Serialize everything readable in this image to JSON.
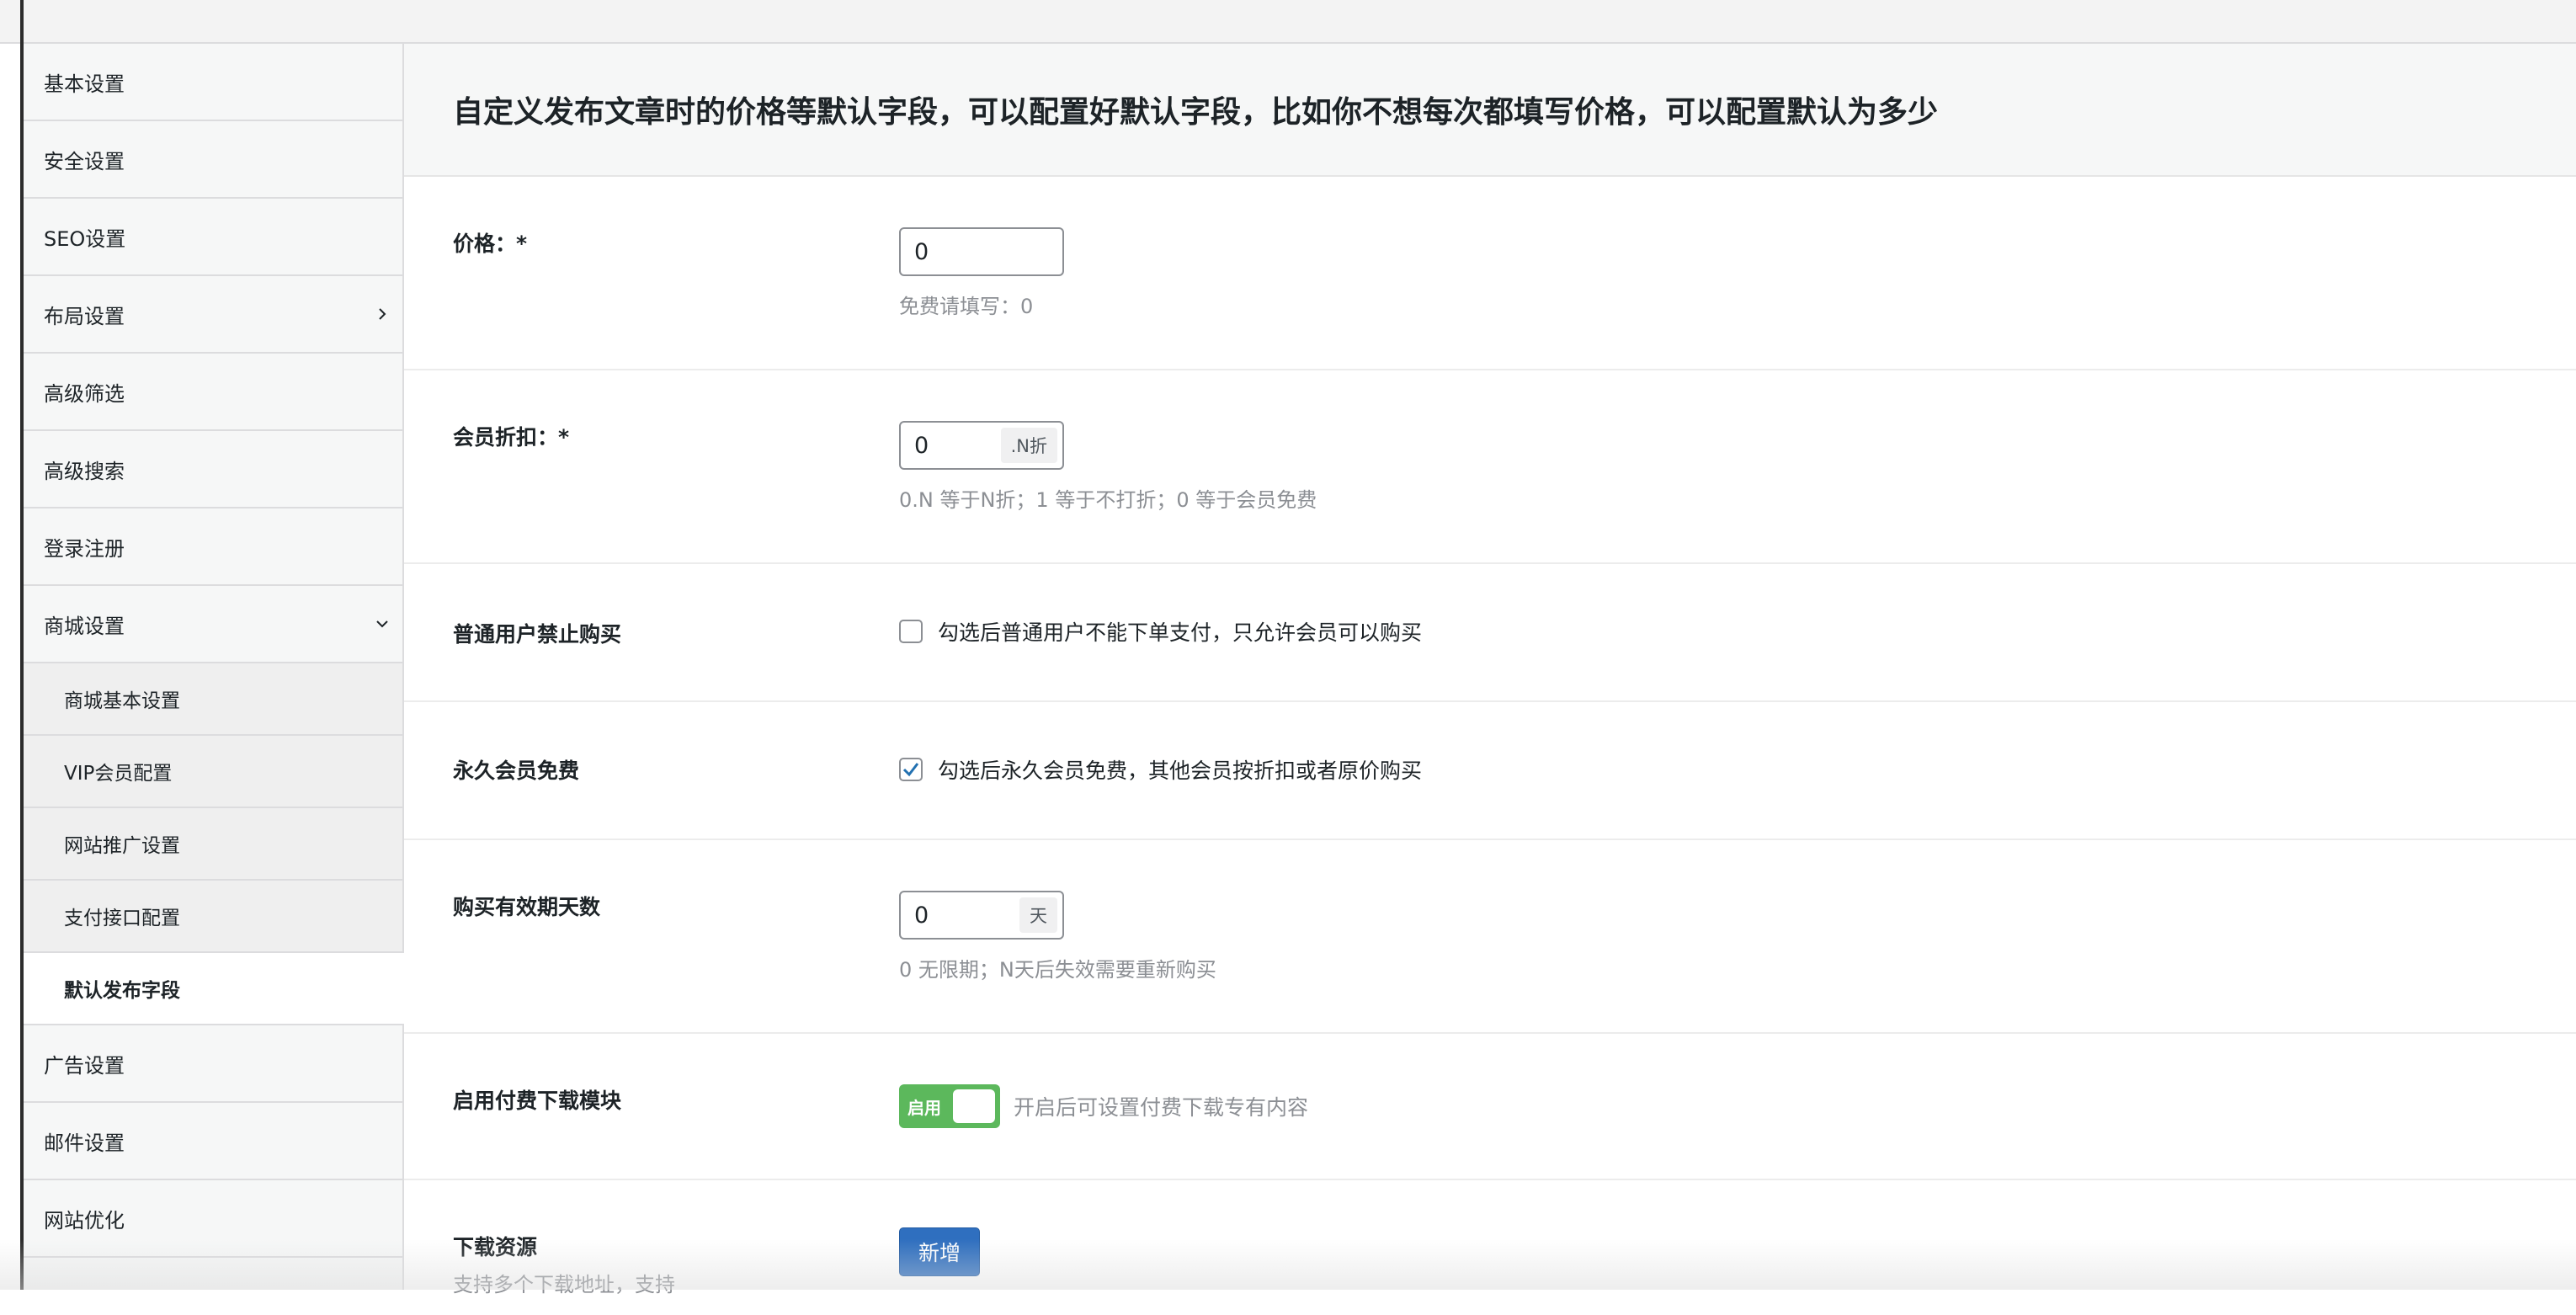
{
  "sidebar": {
    "items": [
      {
        "label": "基本设置"
      },
      {
        "label": "安全设置"
      },
      {
        "label": "SEO设置"
      },
      {
        "label": "布局设置",
        "chevron": "chevron-right-icon"
      },
      {
        "label": "高级筛选"
      },
      {
        "label": "高级搜索"
      },
      {
        "label": "登录注册"
      },
      {
        "label": "商城设置",
        "chevron": "chevron-down-icon"
      }
    ],
    "subitems": [
      {
        "label": "商城基本设置"
      },
      {
        "label": "VIP会员配置"
      },
      {
        "label": "网站推广设置"
      },
      {
        "label": "支付接口配置"
      },
      {
        "label": "默认发布字段",
        "active": true
      }
    ],
    "items_after": [
      {
        "label": "广告设置"
      },
      {
        "label": "邮件设置"
      },
      {
        "label": "网站优化"
      }
    ]
  },
  "main": {
    "title": "自定义发布文章时的价格等默认字段，可以配置好默认字段，比如你不想每次都填写价格，可以配置默认为多少",
    "fields": {
      "price": {
        "label": "价格：*",
        "value": "0",
        "hint": "免费请填写：0"
      },
      "discount": {
        "label": "会员折扣：*",
        "value": "0",
        "suffix": ".N折",
        "hint": "0.N 等于N折；1 等于不打折；0 等于会员免费"
      },
      "no_normal_buy": {
        "label": "普通用户禁止购买",
        "checked": false,
        "text": "勾选后普通用户不能下单支付，只允许会员可以购买"
      },
      "lifetime_free": {
        "label": "永久会员免费",
        "checked": true,
        "text": "勾选后永久会员免费，其他会员按折扣或者原价购买"
      },
      "valid_days": {
        "label": "购买有效期天数",
        "value": "0",
        "suffix": "天",
        "hint": "0 无限期；N天后失效需要重新购买"
      },
      "paid_download": {
        "label": "启用付费下载模块",
        "toggle_label": "启用",
        "enabled": true,
        "desc": "开启后可设置付费下载专有内容"
      },
      "download_res": {
        "label": "下载资源",
        "sub": "支持多个下载地址，支持",
        "button": "新增"
      }
    }
  },
  "colors": {
    "accent": "#2f6fbf",
    "toggle_on": "#5cb85c",
    "check": "#2271b1"
  }
}
